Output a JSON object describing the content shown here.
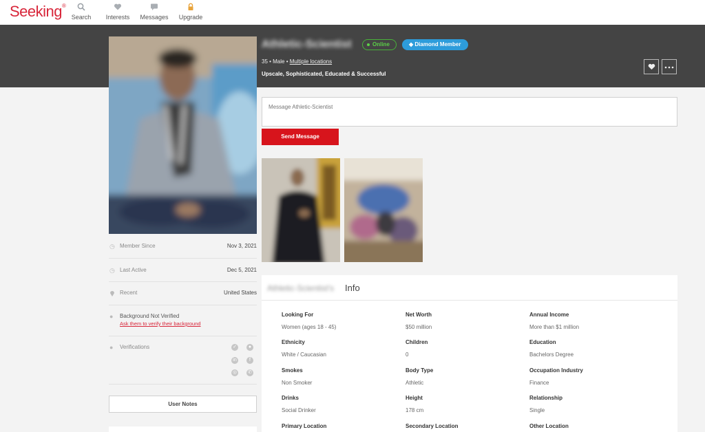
{
  "nav": {
    "logo": "Seeking",
    "logo_mark": "®",
    "items": [
      {
        "label": "Search",
        "icon": "search-icon"
      },
      {
        "label": "Interests",
        "icon": "heart-icon"
      },
      {
        "label": "Messages",
        "icon": "chat-icon"
      },
      {
        "label": "Upgrade",
        "icon": "lock-icon"
      }
    ]
  },
  "profile": {
    "name": "Athletic-Scientist",
    "online_label": "Online",
    "diamond_label": "Diamond Member",
    "meta_prefix": "35 • Male • ",
    "locations_link": "Multiple locations",
    "tagline": "Upscale, Sophisticated, Educated & Successful"
  },
  "stats": {
    "member_since_label": "Member Since",
    "member_since_value": "Nov 3, 2021",
    "last_active_label": "Last Active",
    "last_active_value": "Dec 5, 2021",
    "recent_label": "Recent",
    "recent_value": "United States",
    "background_label": "Background Not Verified",
    "background_link": "Ask them to verify their background",
    "verifications_label": "Verifications",
    "user_notes_button": "User Notes"
  },
  "message": {
    "placeholder": "Message Athletic-Scientist",
    "send_label": "Send Message"
  },
  "info": {
    "name_possessive": "Athletic-Scientist's",
    "heading": "Info",
    "fields": [
      {
        "label": "Looking For",
        "value": "Women (ages 18 - 45)"
      },
      {
        "label": "Net Worth",
        "value": "$50 million"
      },
      {
        "label": "Annual Income",
        "value": "More than $1 million"
      },
      {
        "label": "Ethnicity",
        "value": "White / Caucasian"
      },
      {
        "label": "Children",
        "value": "0"
      },
      {
        "label": "Education",
        "value": "Bachelors Degree"
      },
      {
        "label": "Smokes",
        "value": "Non Smoker"
      },
      {
        "label": "Body Type",
        "value": "Athletic"
      },
      {
        "label": "Occupation Industry",
        "value": "Finance"
      },
      {
        "label": "Drinks",
        "value": "Social Drinker"
      },
      {
        "label": "Height",
        "value": "178 cm"
      },
      {
        "label": "Relationship",
        "value": "Single"
      },
      {
        "label": "Primary Location",
        "value": ""
      },
      {
        "label": "Secondary Location",
        "value": ""
      },
      {
        "label": "Other Location",
        "value": ""
      }
    ]
  },
  "colors": {
    "brand_red": "#d8263a",
    "send_red": "#d7141c",
    "header_band": "#444444",
    "online_green": "#5cd048",
    "diamond_blue": "#2d9cdb"
  }
}
